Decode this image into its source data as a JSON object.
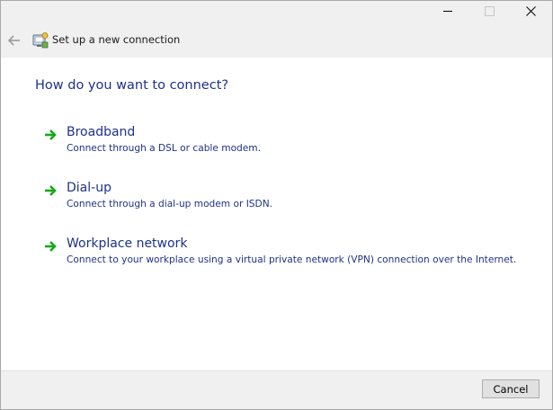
{
  "window": {
    "title": "Set up a new connection"
  },
  "heading": "How do you want to connect?",
  "options": [
    {
      "title": "Broadband",
      "description": "Connect through a DSL or cable modem.",
      "icon": "green-arrow-icon"
    },
    {
      "title": "Dial-up",
      "description": "Connect through a dial-up modem or ISDN.",
      "icon": "green-arrow-icon"
    },
    {
      "title": "Workplace network",
      "description": "Connect to your workplace using a virtual private network (VPN) connection over the Internet.",
      "icon": "green-arrow-icon"
    }
  ],
  "footer": {
    "cancel_label": "Cancel"
  },
  "colors": {
    "link_text": "#1e3287",
    "arrow_green": "#1aa81a",
    "titlebar_bg": "#f0f0f0"
  }
}
